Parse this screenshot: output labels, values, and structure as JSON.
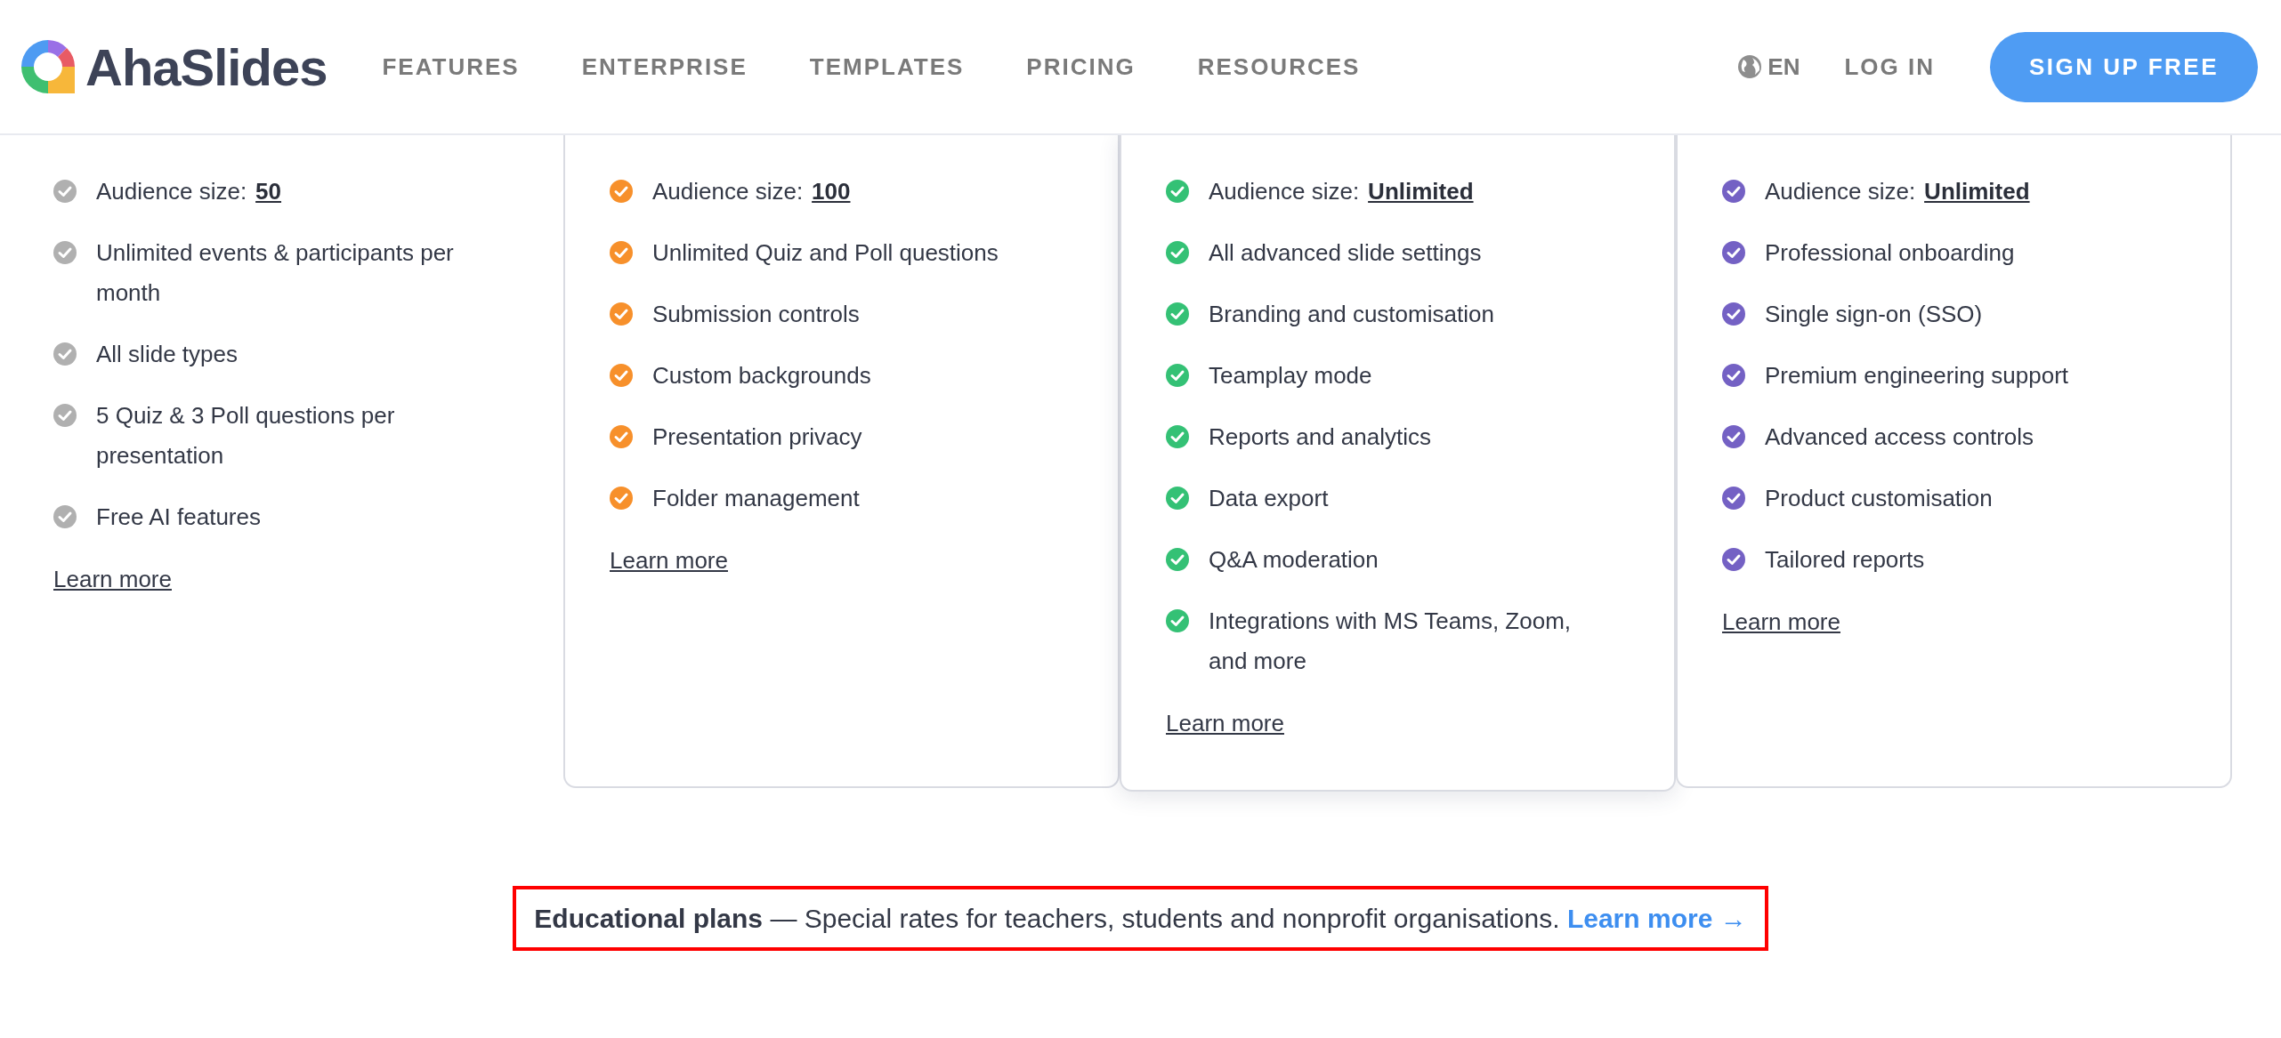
{
  "header": {
    "brand": "AhaSlides",
    "nav": [
      {
        "label": "FEATURES"
      },
      {
        "label": "ENTERPRISE"
      },
      {
        "label": "TEMPLATES"
      },
      {
        "label": "PRICING"
      },
      {
        "label": "RESOURCES"
      }
    ],
    "language": "EN",
    "login": "LOG IN",
    "signup": "SIGN UP FREE"
  },
  "plans": [
    {
      "color": "#b0b0b0",
      "bordered": false,
      "featured": false,
      "features": [
        {
          "text": "Audience size:",
          "value": "50"
        },
        {
          "text": "Unlimited events & participants per month"
        },
        {
          "text": "All slide types"
        },
        {
          "text": "5 Quiz & 3 Poll questions per presentation"
        },
        {
          "text": "Free AI features"
        }
      ],
      "link": "Learn more"
    },
    {
      "color": "#f7902b",
      "bordered": true,
      "featured": false,
      "features": [
        {
          "text": "Audience size:",
          "value": "100"
        },
        {
          "text": "Unlimited Quiz and Poll questions"
        },
        {
          "text": "Submission controls"
        },
        {
          "text": "Custom backgrounds"
        },
        {
          "text": "Presentation privacy"
        },
        {
          "text": "Folder management"
        }
      ],
      "link": "Learn more"
    },
    {
      "color": "#34c175",
      "bordered": true,
      "featured": true,
      "features": [
        {
          "text": "Audience size:",
          "value": "Unlimited"
        },
        {
          "text": "All advanced slide settings"
        },
        {
          "text": "Branding and customisation"
        },
        {
          "text": "Teamplay mode"
        },
        {
          "text": "Reports and analytics"
        },
        {
          "text": "Data export"
        },
        {
          "text": "Q&A moderation"
        },
        {
          "text": "Integrations with MS Teams, Zoom, and more"
        }
      ],
      "link": "Learn more"
    },
    {
      "color": "#7461c4",
      "bordered": true,
      "featured": false,
      "features": [
        {
          "text": "Audience size:",
          "value": "Unlimited"
        },
        {
          "text": "Professional onboarding"
        },
        {
          "text": "Single sign-on (SSO)"
        },
        {
          "text": "Premium engineering support"
        },
        {
          "text": "Advanced access controls"
        },
        {
          "text": "Product customisation"
        },
        {
          "text": "Tailored reports"
        }
      ],
      "link": "Learn more"
    }
  ],
  "banner": {
    "text": "**Educational plans** — Special rates for teachers, students and nonprofit organisations.",
    "link": "Learn more →"
  }
}
